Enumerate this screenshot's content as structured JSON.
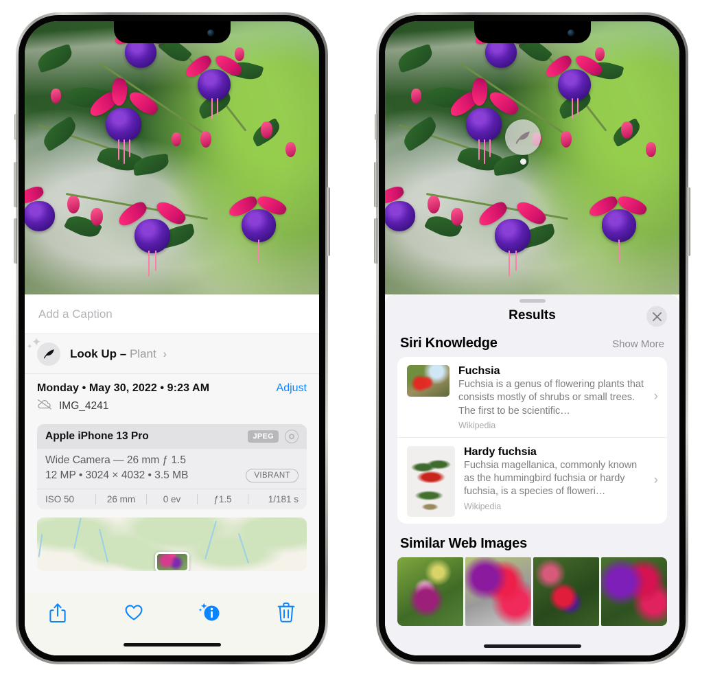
{
  "left_phone": {
    "name": "photos-detail-screen",
    "caption_placeholder": "Add a Caption",
    "lookup": {
      "label": "Look Up",
      "dash": "–",
      "subject": "Plant",
      "chevron": "›",
      "icon": "leaf-icon"
    },
    "meta": {
      "date": "Monday • May 30, 2022 • 9:23 AM",
      "adjust_label": "Adjust",
      "filename": "IMG_4241",
      "cloud_icon": "cloud-slash-icon"
    },
    "camera": {
      "device": "Apple iPhone 13 Pro",
      "format_badge": "JPEG",
      "hdr_icon": "hdr-ring-icon",
      "lens": "Wide Camera — 26 mm ƒ 1.5",
      "specs": "12 MP • 3024 × 4032 • 3.5 MB",
      "style_badge": "VIBRANT",
      "exif": [
        "ISO 50",
        "26 mm",
        "0 ev",
        "ƒ1.5",
        "1/181 s"
      ]
    },
    "toolbar": [
      {
        "name": "share-button",
        "icon": "share-icon"
      },
      {
        "name": "favorite-button",
        "icon": "heart-icon"
      },
      {
        "name": "info-button",
        "icon": "info-sparkle-icon"
      },
      {
        "name": "delete-button",
        "icon": "trash-icon"
      }
    ]
  },
  "right_phone": {
    "name": "visual-look-up-results-screen",
    "badge": {
      "icon": "leaf-icon",
      "name": "visual-look-up-badge"
    },
    "results": {
      "title": "Results",
      "close_icon": "close-icon",
      "siri_knowledge": {
        "section_title": "Siri Knowledge",
        "show_more": "Show More",
        "items": [
          {
            "title": "Fuchsia",
            "description": "Fuchsia is a genus of flowering plants that consists mostly of shrubs or small trees. The first to be scientific…",
            "source": "Wikipedia",
            "thumb": "fuchsia-flowers-thumbnail"
          },
          {
            "title": "Hardy fuchsia",
            "description": "Fuchsia magellanica, commonly known as the hummingbird fuchsia or hardy fuchsia, is a species of floweri…",
            "source": "Wikipedia",
            "thumb": "hardy-fuchsia-specimen-thumbnail"
          }
        ]
      },
      "similar_web_images": {
        "section_title": "Similar Web Images",
        "items": [
          "similar-image-1",
          "similar-image-2",
          "similar-image-3",
          "similar-image-4"
        ]
      }
    }
  },
  "colors": {
    "accent_blue": "#0a84ff",
    "sheet_bg": "#f7f7f7",
    "results_bg": "#f2f1f6",
    "secondary_text": "#8b8b90"
  }
}
